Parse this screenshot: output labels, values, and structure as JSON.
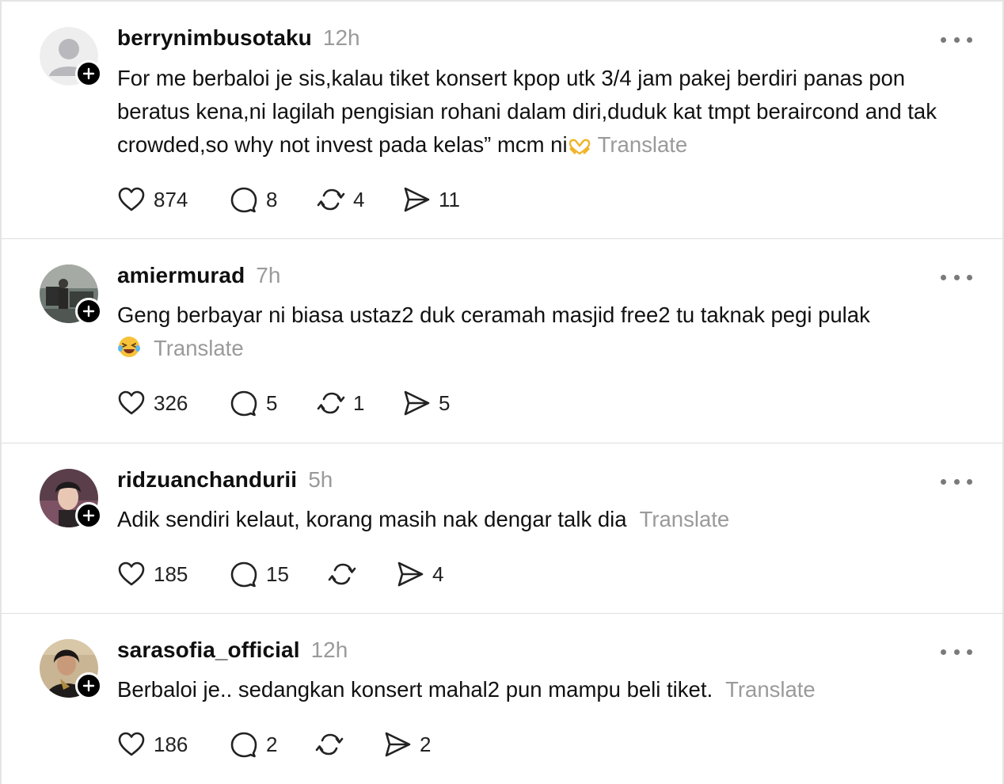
{
  "translate_label": "Translate",
  "posts": [
    {
      "username": "berrynimbusotaku",
      "time": "12h",
      "text": "For me berbaloi je sis,kalau tiket konsert kpop utk 3/4 jam pakej berdiri panas pon beratus kena,ni lagilah pengisian rohani dalam diri,duduk kat tmpt beraircond and tak crowded,so why not invest pada kelas” mcm ni",
      "emoji": "heart-hands-emoji",
      "likes": "874",
      "replies": "8",
      "reposts": "4",
      "shares": "11",
      "avatar": "default-avatar"
    },
    {
      "username": "amiermurad",
      "time": "7h",
      "text": "Geng berbayar ni biasa ustaz2 duk ceramah masjid free2 tu taknak pegi pulak",
      "emoji": "laughing-tears-emoji",
      "likes": "326",
      "replies": "5",
      "reposts": "1",
      "shares": "5",
      "avatar": "photo-avatar"
    },
    {
      "username": "ridzuanchandurii",
      "time": "5h",
      "text": "Adik sendiri kelaut, korang masih nak dengar talk dia",
      "likes": "185",
      "replies": "15",
      "reposts": "",
      "shares": "4",
      "avatar": "photo-avatar"
    },
    {
      "username": "sarasofia_official",
      "time": "12h",
      "text": "Berbaloi je.. sedangkan konsert mahal2 pun mampu beli tiket.",
      "likes": "186",
      "replies": "2",
      "reposts": "",
      "shares": "2",
      "avatar": "photo-avatar"
    }
  ],
  "colors": {
    "muted": "#9a9a9a",
    "text": "#111111",
    "divider": "#dedede"
  }
}
